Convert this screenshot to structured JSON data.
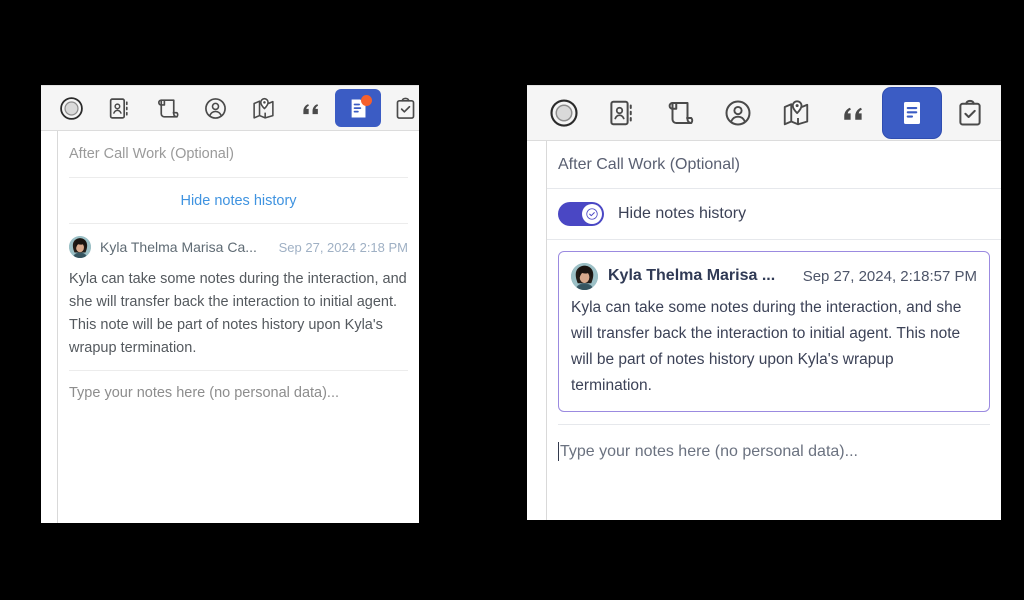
{
  "colors": {
    "accent_blue": "#3b5cc4",
    "badge_orange": "#f5602d",
    "link_blue": "#3f93e0",
    "toggle_indigo": "#4a47c4",
    "card_border_purple": "#9b8ae0"
  },
  "toolbar": {
    "tabs": [
      {
        "icon": "record-circle-icon",
        "label": "Record",
        "selected": false,
        "badge": false
      },
      {
        "icon": "contact-book-icon",
        "label": "Contact",
        "selected": false,
        "badge": false
      },
      {
        "icon": "script-scroll-icon",
        "label": "Script",
        "selected": false,
        "badge": false
      },
      {
        "icon": "user-circle-icon",
        "label": "Customer",
        "selected": false,
        "badge": false
      },
      {
        "icon": "map-pin-icon",
        "label": "Location",
        "selected": false,
        "badge": false
      },
      {
        "icon": "quote-icon",
        "label": "Quote",
        "selected": false,
        "badge": false
      },
      {
        "icon": "notes-document-icon",
        "label": "Notes",
        "selected": true,
        "badge": true
      },
      {
        "icon": "clipboard-check-icon",
        "label": "Tasks",
        "selected": false,
        "badge": false
      }
    ]
  },
  "left_panel": {
    "section_title": "After Call Work (Optional)",
    "hide_notes_label": "Hide notes history",
    "note": {
      "author": "Kyla Thelma Marisa Ca...",
      "timestamp": "Sep 27, 2024 2:18 PM",
      "body": "Kyla can take some notes during the interaction, and she will transfer back the interaction to initial agent. This note will be part of notes history upon Kyla's wrapup termination."
    },
    "composer_placeholder": "Type your notes here (no personal data)..."
  },
  "right_panel": {
    "section_title": "After Call Work (Optional)",
    "hide_notes_label": "Hide notes history",
    "toggle_state": "on",
    "note": {
      "author": "Kyla Thelma Marisa ...",
      "timestamp": "Sep 27, 2024, 2:18:57 PM",
      "body": "Kyla can take some notes during the interaction, and she will transfer back the interaction to initial agent. This note will be part of notes history upon Kyla's wrapup termination."
    },
    "composer_placeholder": "Type your notes here (no personal data)..."
  }
}
